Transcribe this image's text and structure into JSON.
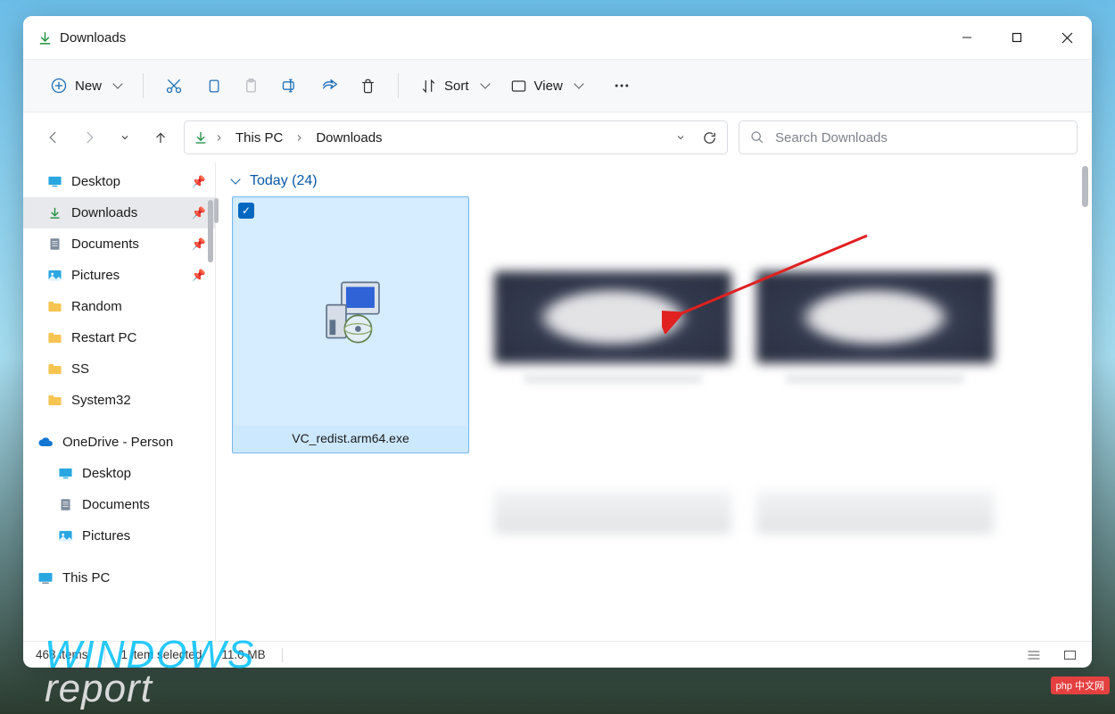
{
  "window": {
    "title": "Downloads"
  },
  "toolbar": {
    "new_label": "New",
    "sort_label": "Sort",
    "view_label": "View"
  },
  "breadcrumb": {
    "root": "This PC",
    "current": "Downloads"
  },
  "search": {
    "placeholder": "Search Downloads"
  },
  "sidebar": {
    "items": [
      {
        "label": "Desktop",
        "icon": "desktop",
        "pin": true
      },
      {
        "label": "Downloads",
        "icon": "download",
        "pin": true,
        "selected": true
      },
      {
        "label": "Documents",
        "icon": "document",
        "pin": true
      },
      {
        "label": "Pictures",
        "icon": "pictures",
        "pin": true
      },
      {
        "label": "Random",
        "icon": "folder"
      },
      {
        "label": "Restart PC",
        "icon": "folder"
      },
      {
        "label": "SS",
        "icon": "folder"
      },
      {
        "label": "System32",
        "icon": "folder"
      }
    ],
    "onedrive_label": "OneDrive - Person",
    "onedrive_children": [
      {
        "label": "Desktop",
        "icon": "desktop"
      },
      {
        "label": "Documents",
        "icon": "document"
      },
      {
        "label": "Pictures",
        "icon": "pictures"
      }
    ],
    "thispc_label": "This PC"
  },
  "content": {
    "group_header": "Today (24)",
    "selected_file": "VC_redist.arm64.exe"
  },
  "statusbar": {
    "count": "468 items",
    "selection": "1 item selected",
    "size": "11.0 MB"
  },
  "watermark": {
    "line1": "WINDOWS",
    "line2": "report",
    "br": "php 中文网"
  }
}
